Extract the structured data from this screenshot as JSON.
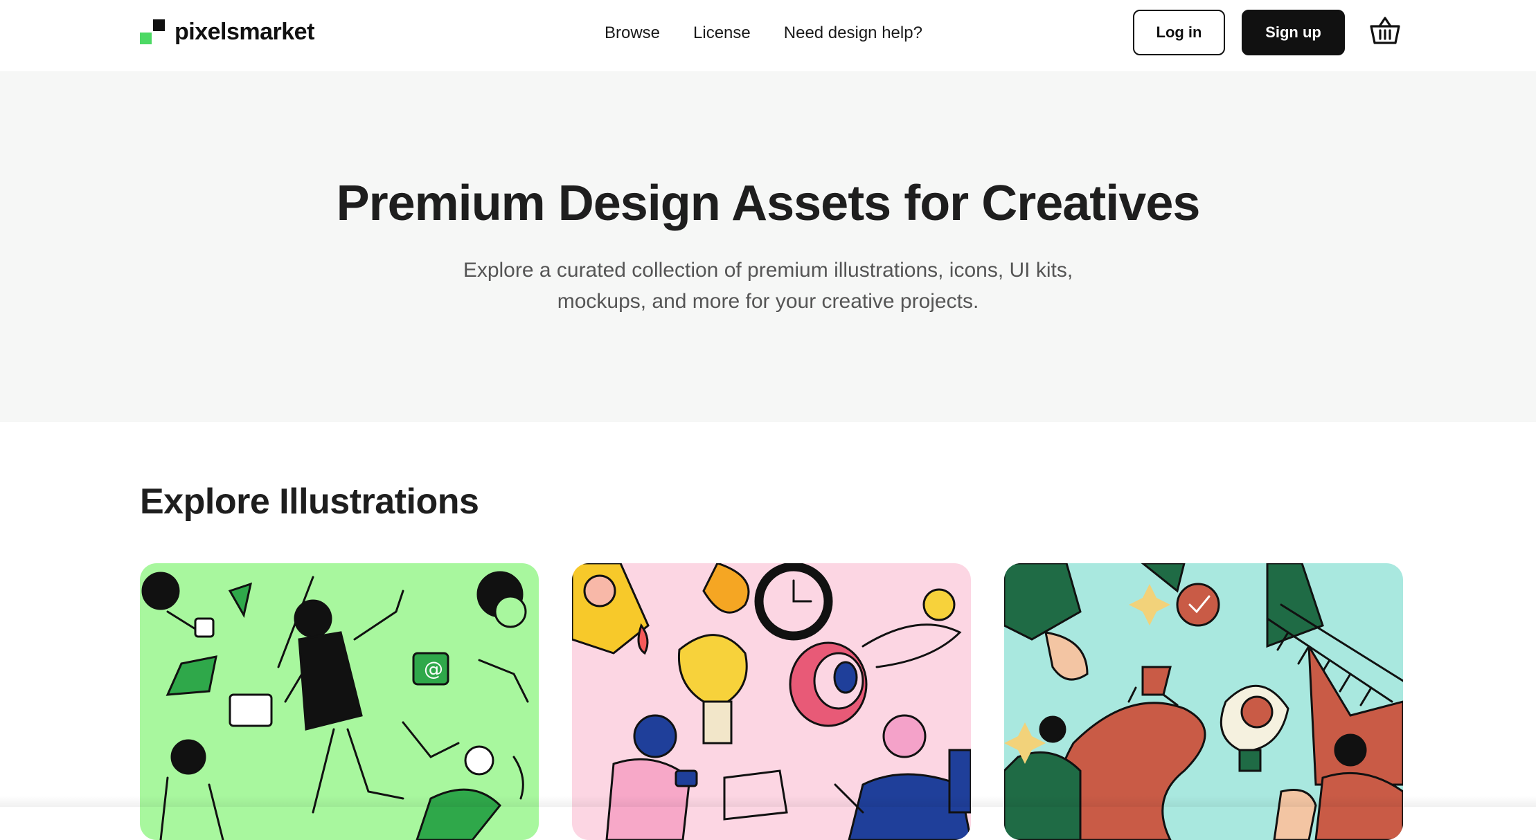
{
  "brand": {
    "name": "pixelsmarket",
    "colors": {
      "dark": "#111111",
      "green": "#4cd964"
    }
  },
  "nav": {
    "items": [
      "Browse",
      "License",
      "Need design help?"
    ]
  },
  "auth": {
    "login_label": "Log in",
    "signup_label": "Sign up"
  },
  "cart": {
    "icon": "basket-icon"
  },
  "hero": {
    "title": "Premium Design Assets for Creatives",
    "subtitle_line1": "Explore a curated collection of premium illustrations, icons, UI kits,",
    "subtitle_line2": "mockups, and more for your creative projects."
  },
  "section": {
    "title": "Explore Illustrations"
  },
  "cards": [
    {
      "bg": "#a8f79e"
    },
    {
      "bg": "#fcd6e3"
    },
    {
      "bg": "#a9e8df"
    }
  ]
}
